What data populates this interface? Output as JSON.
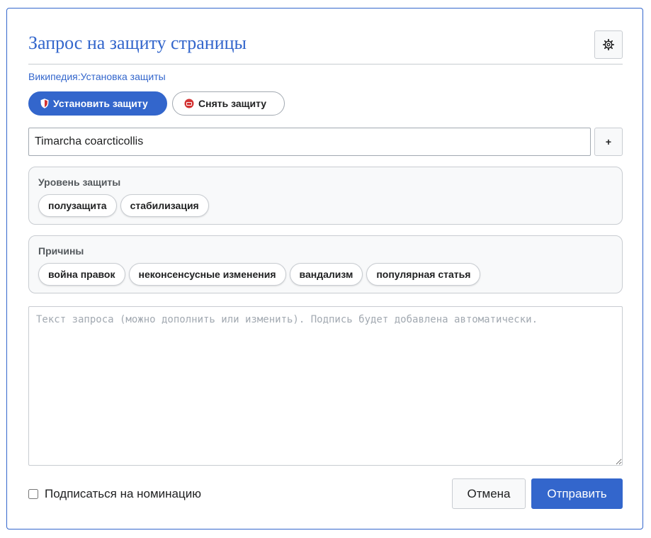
{
  "dialog": {
    "title": "Запрос на защиту страницы",
    "settings_icon": "gear-icon",
    "wiki_link": "Википедия:Установка защиты"
  },
  "modes": {
    "set_label": "Установить защиту",
    "set_icon": "shield-icon",
    "unset_label": "Снять защиту",
    "unset_icon": "unlock-icon"
  },
  "page": {
    "value": "Timarcha coarcticollis",
    "add_label": "+"
  },
  "protection_level": {
    "label": "Уровень защиты",
    "options": [
      "полузащита",
      "стабилизация"
    ]
  },
  "reasons": {
    "label": "Причины",
    "options": [
      "война правок",
      "неконсенсусные изменения",
      "вандализм",
      "популярная статья"
    ]
  },
  "request": {
    "placeholder": "Текст запроса (можно дополнить или изменить). Подпись будет добавлена автоматически."
  },
  "footer": {
    "subscribe_label": "Подписаться на номинацию",
    "cancel_label": "Отмена",
    "send_label": "Отправить"
  },
  "colors": {
    "accent": "#3366cc",
    "border": "#c8ccd1",
    "section_bg": "#f8f9fa",
    "shield_red": "#d33333"
  }
}
